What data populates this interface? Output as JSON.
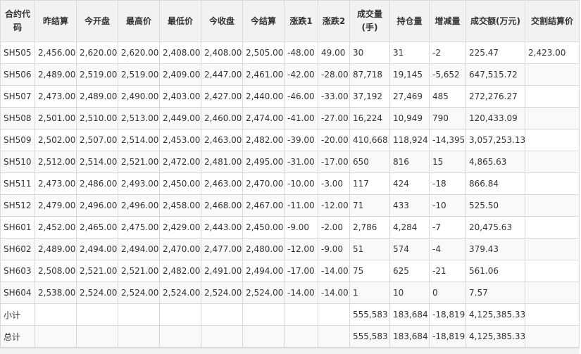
{
  "table": {
    "headers": [
      "合约代码",
      "昨结算",
      "今开盘",
      "最高价",
      "最低价",
      "今收盘",
      "今结算",
      "涨跌1",
      "涨跌2",
      "成交量(手)",
      "持仓量",
      "增减量",
      "成交额(万元)",
      "交割结算价"
    ],
    "rows": [
      [
        "SH505",
        "2,456.00",
        "2,620.00",
        "2,620.00",
        "2,408.00",
        "2,408.00",
        "2,505.00",
        "-48.00",
        "49.00",
        "30",
        "31",
        "-2",
        "225.47",
        "2,423.00"
      ],
      [
        "SH506",
        "2,489.00",
        "2,519.00",
        "2,519.00",
        "2,409.00",
        "2,447.00",
        "2,461.00",
        "-42.00",
        "-28.00",
        "87,718",
        "19,145",
        "-5,652",
        "647,515.72",
        ""
      ],
      [
        "SH507",
        "2,473.00",
        "2,489.00",
        "2,490.00",
        "2,403.00",
        "2,427.00",
        "2,440.00",
        "-46.00",
        "-33.00",
        "37,192",
        "27,469",
        "485",
        "272,276.27",
        ""
      ],
      [
        "SH508",
        "2,501.00",
        "2,510.00",
        "2,513.00",
        "2,449.00",
        "2,460.00",
        "2,474.00",
        "-41.00",
        "-27.00",
        "16,224",
        "10,949",
        "790",
        "120,433.09",
        ""
      ],
      [
        "SH509",
        "2,502.00",
        "2,507.00",
        "2,514.00",
        "2,453.00",
        "2,463.00",
        "2,482.00",
        "-39.00",
        "-20.00",
        "410,668",
        "118,924",
        "-14,395",
        "3,057,253.13",
        ""
      ],
      [
        "SH510",
        "2,512.00",
        "2,514.00",
        "2,521.00",
        "2,472.00",
        "2,481.00",
        "2,495.00",
        "-31.00",
        "-17.00",
        "650",
        "816",
        "15",
        "4,865.63",
        ""
      ],
      [
        "SH511",
        "2,473.00",
        "2,486.00",
        "2,493.00",
        "2,450.00",
        "2,463.00",
        "2,470.00",
        "-10.00",
        "-3.00",
        "117",
        "424",
        "-18",
        "866.84",
        ""
      ],
      [
        "SH512",
        "2,479.00",
        "2,496.00",
        "2,496.00",
        "2,458.00",
        "2,468.00",
        "2,467.00",
        "-11.00",
        "-12.00",
        "71",
        "433",
        "-10",
        "525.50",
        ""
      ],
      [
        "SH601",
        "2,452.00",
        "2,465.00",
        "2,475.00",
        "2,429.00",
        "2,443.00",
        "2,450.00",
        "-9.00",
        "-2.00",
        "2,786",
        "4,284",
        "-7",
        "20,475.63",
        ""
      ],
      [
        "SH602",
        "2,489.00",
        "2,494.00",
        "2,494.00",
        "2,470.00",
        "2,477.00",
        "2,480.00",
        "-12.00",
        "-9.00",
        "51",
        "574",
        "-4",
        "379.43",
        ""
      ],
      [
        "SH603",
        "2,508.00",
        "2,521.00",
        "2,521.00",
        "2,482.00",
        "2,491.00",
        "2,494.00",
        "-17.00",
        "-14.00",
        "75",
        "625",
        "-21",
        "561.06",
        ""
      ],
      [
        "SH604",
        "2,538.00",
        "2,524.00",
        "2,524.00",
        "2,524.00",
        "2,524.00",
        "2,524.00",
        "-14.00",
        "-14.00",
        "1",
        "10",
        "0",
        "7.57",
        ""
      ],
      [
        "小计",
        "",
        "",
        "",
        "",
        "",
        "",
        "",
        "",
        "555,583",
        "183,684",
        "-18,819",
        "4,125,385.33",
        ""
      ],
      [
        "总计",
        "",
        "",
        "",
        "",
        "",
        "",
        "",
        "",
        "555,583",
        "183,684",
        "-18,819",
        "4,125,385.33",
        ""
      ]
    ]
  }
}
